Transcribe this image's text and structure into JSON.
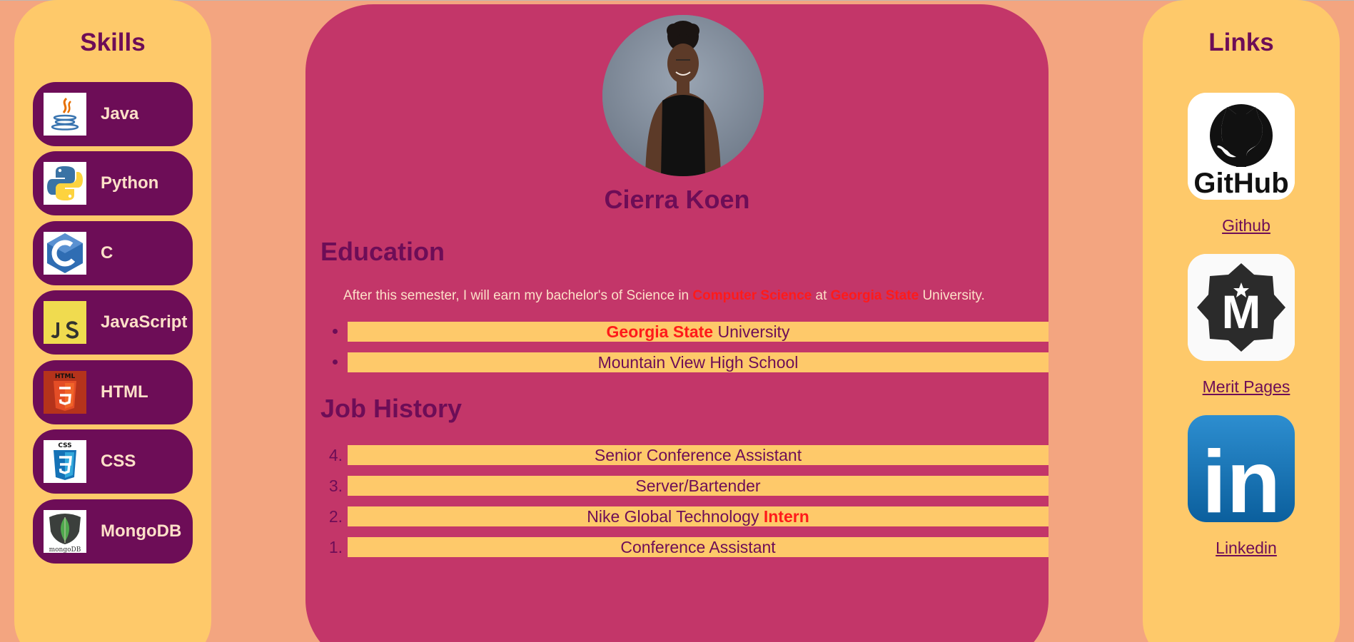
{
  "skills": {
    "title": "Skills",
    "items": [
      {
        "label": "Java",
        "icon": "java-icon"
      },
      {
        "label": "Python",
        "icon": "python-icon"
      },
      {
        "label": "C",
        "icon": "c-language-icon"
      },
      {
        "label": "JavaScript",
        "icon": "javascript-icon"
      },
      {
        "label": "HTML",
        "icon": "html5-icon"
      },
      {
        "label": "CSS",
        "icon": "css3-icon"
      },
      {
        "label": "MongoDB",
        "icon": "mongodb-icon"
      }
    ],
    "html_icon_text": "HTML",
    "css_icon_text": "CSS",
    "mongodb_icon_text": "mongoDB"
  },
  "profile": {
    "name": "Cierra Koen"
  },
  "education": {
    "heading": "Education",
    "para_before": "After this semester, I will earn my bachelor's of Science in ",
    "para_highlight1": "Computer Science",
    "para_mid": " at ",
    "para_highlight2": "Georgia State",
    "para_after": " University.",
    "schools": [
      {
        "highlight": "Georgia State",
        "rest": " University"
      },
      {
        "highlight": "",
        "rest": "Mountain View High School"
      }
    ]
  },
  "jobs": {
    "heading": "Job History",
    "items": [
      {
        "number": "4.",
        "text": "Senior Conference Assistant",
        "highlight": ""
      },
      {
        "number": "3.",
        "text": "Server/Bartender",
        "highlight": ""
      },
      {
        "number": "2.",
        "text": "Nike Global Technology ",
        "highlight": "Intern"
      },
      {
        "number": "1.",
        "text": "Conference Assistant",
        "highlight": ""
      }
    ]
  },
  "links": {
    "title": "Links",
    "github_label": "Github",
    "github_logo_text": "GitHub",
    "merit_label": "Merit Pages",
    "merit_logo_text": "M",
    "linkedin_label": "Linkedin",
    "linkedin_logo_text": "in"
  },
  "colors": {
    "background": "#f3a580",
    "panel": "#fec96a",
    "card": "#c33669",
    "accent": "#6d0d57",
    "highlight": "#ff1a1a",
    "text_light": "#fde0c8"
  }
}
